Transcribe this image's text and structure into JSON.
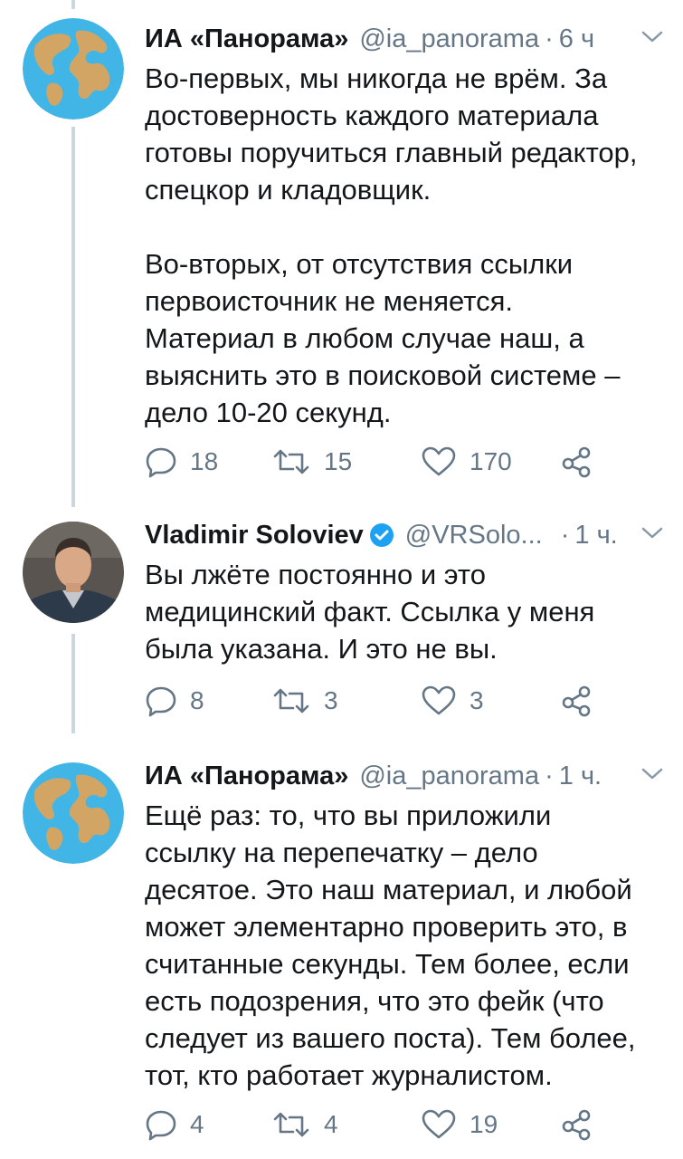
{
  "tweets": [
    {
      "author": "ИА «Панорама»",
      "handle": "@ia_panorama",
      "time": "6 ч",
      "text": "Во-первых, мы никогда не врём. За\nдостоверность каждого материала\nготовы поручиться главный редактор,\nспецкор и кладовщик.\n\nВо-вторых, от отсутствия ссылки\nпервоисточник не меняется.\nМатериал в любом случае наш, а\nвыяснить это в поисковой системе –\nдело 10-20 секунд.",
      "replies": "18",
      "retweets": "15",
      "likes": "170",
      "avatar": "globe-avatar"
    },
    {
      "author": "Vladimir Soloviev",
      "verified": true,
      "handle": "@VRSolo...",
      "time": "1 ч.",
      "text": "Вы лжёте постоянно и это\nмедицинский факт. Ссылка у меня\nбыла указана. И это не вы.",
      "replies": "8",
      "retweets": "3",
      "likes": "3",
      "avatar": "photo-avatar"
    },
    {
      "author": "ИА «Панорама»",
      "handle": "@ia_panorama",
      "time": "1 ч.",
      "text": "Ещё раз: то, что вы приложили\nссылку на перепечатку – дело\nдесятое. Это наш материал, и любой\nможет элементарно проверить это, в\nсчитанные секунды. Тем более, если\nесть подозрения, что это фейк (что\nследует из вашего поста). Тем более,\nтот, кто работает журналистом.",
      "replies": "4",
      "retweets": "4",
      "likes": "19",
      "avatar": "globe-avatar"
    }
  ],
  "colors": {
    "text": "#14171a",
    "secondary": "#657786",
    "thread_line": "#ccd6dd",
    "verified": "#1da1f2",
    "globe_water": "#41b6e6",
    "globe_land": "#d2a565"
  }
}
